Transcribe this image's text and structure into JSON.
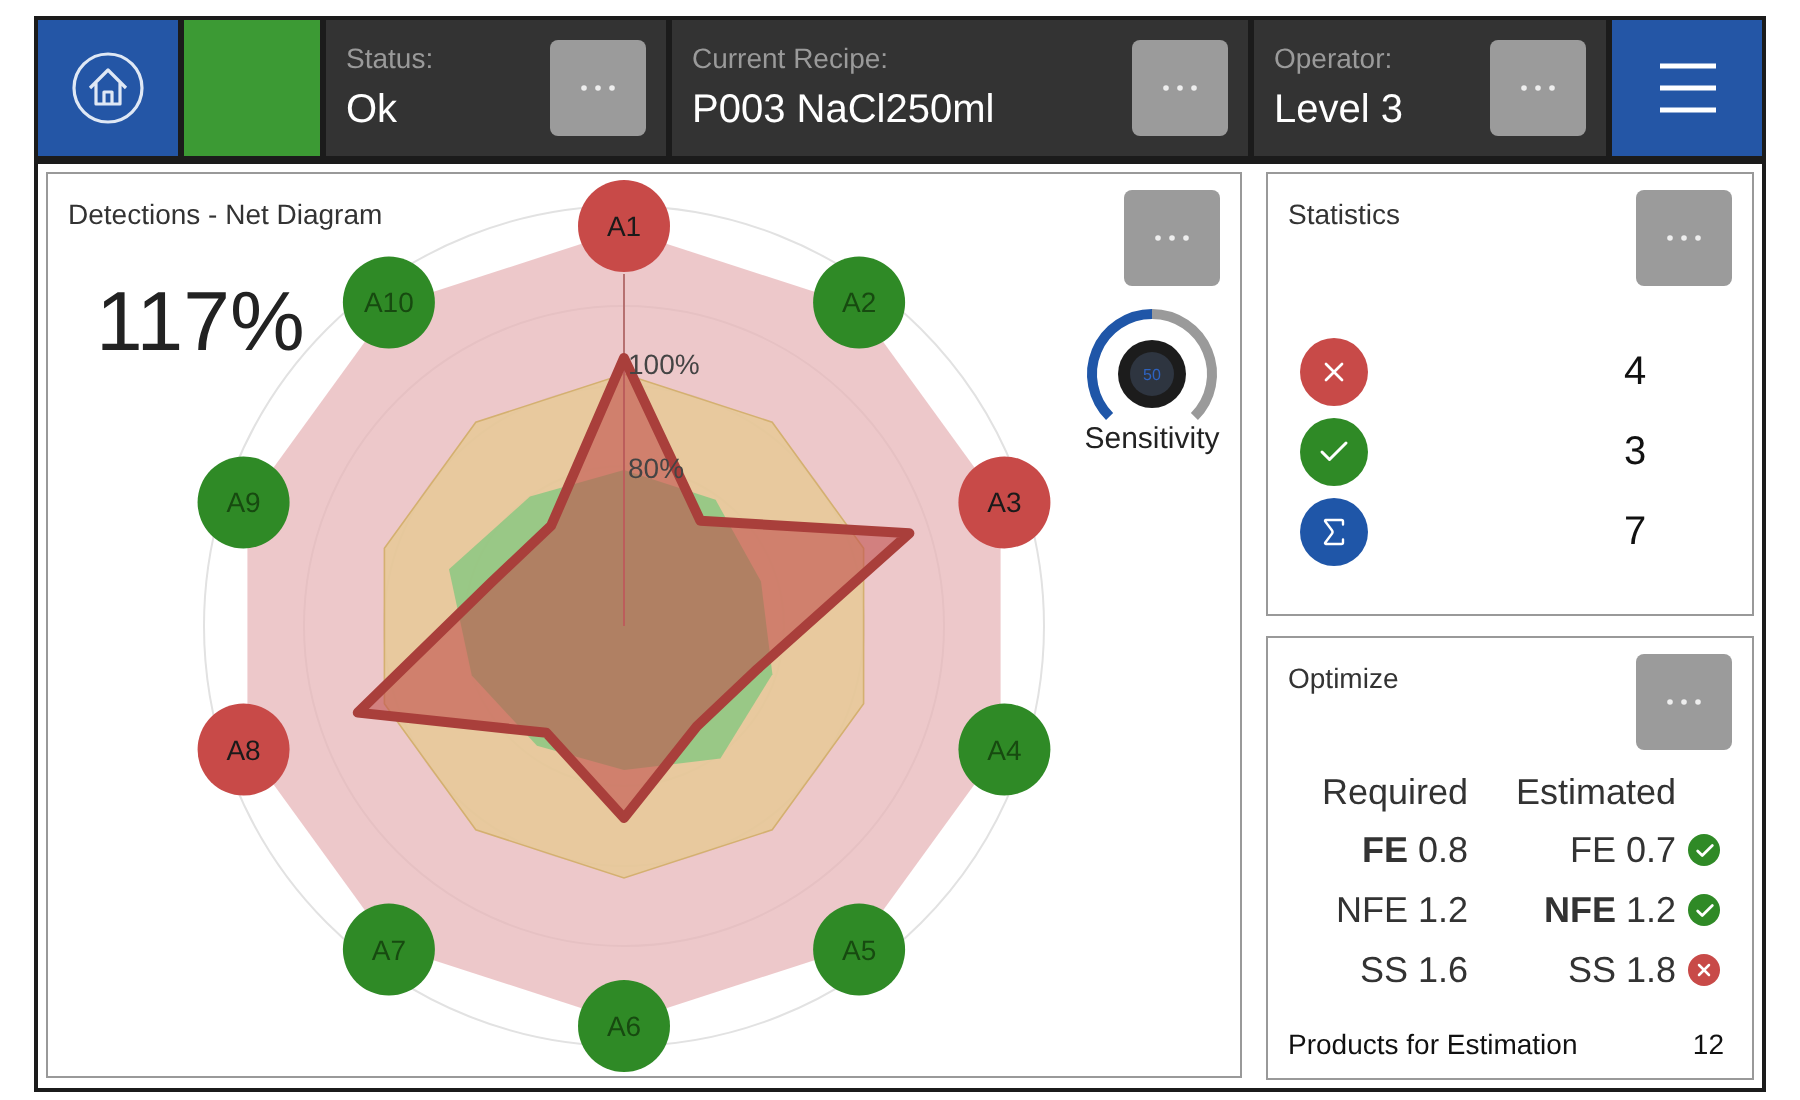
{
  "header": {
    "fields": [
      {
        "label": "Status:",
        "value": "Ok"
      },
      {
        "label": "Current Recipe:",
        "value": "P003 NaCl250ml"
      },
      {
        "label": "Operator:",
        "value": "Level 3"
      }
    ]
  },
  "net_diagram": {
    "title": "Detections - Net Diagram",
    "percent": "117%",
    "ring_labels": [
      "100%",
      "80%"
    ],
    "axes": [
      {
        "label": "A1",
        "color": "#c84a48"
      },
      {
        "label": "A2",
        "color": "#2f8a26"
      },
      {
        "label": "A3",
        "color": "#c84a48"
      },
      {
        "label": "A4",
        "color": "#2f8a26"
      },
      {
        "label": "A5",
        "color": "#2f8a26"
      },
      {
        "label": "A6",
        "color": "#2f8a26"
      },
      {
        "label": "A7",
        "color": "#2f8a26"
      },
      {
        "label": "A8",
        "color": "#c84a48"
      },
      {
        "label": "A9",
        "color": "#2f8a26"
      },
      {
        "label": "A10",
        "color": "#2f8a26"
      }
    ],
    "sensitivity": {
      "label": "Sensitivity",
      "value": "50"
    }
  },
  "statistics": {
    "title": "Statistics",
    "rows": [
      {
        "kind": "fail",
        "value": "4"
      },
      {
        "kind": "pass",
        "value": "3"
      },
      {
        "kind": "total",
        "value": "7"
      }
    ]
  },
  "optimize": {
    "title": "Optimize",
    "headers": [
      "Required",
      "Estimated"
    ],
    "rows": [
      {
        "required": "**FE** 0.8",
        "estimated": "FE 0.7",
        "ok": true
      },
      {
        "required": "NFE 1.2",
        "estimated": "**NFE** 1.2",
        "ok": true
      },
      {
        "required": "SS 1.6",
        "estimated": "SS 1.8",
        "ok": false
      }
    ],
    "products_label": "Products for Estimation",
    "products_count": "12"
  }
}
